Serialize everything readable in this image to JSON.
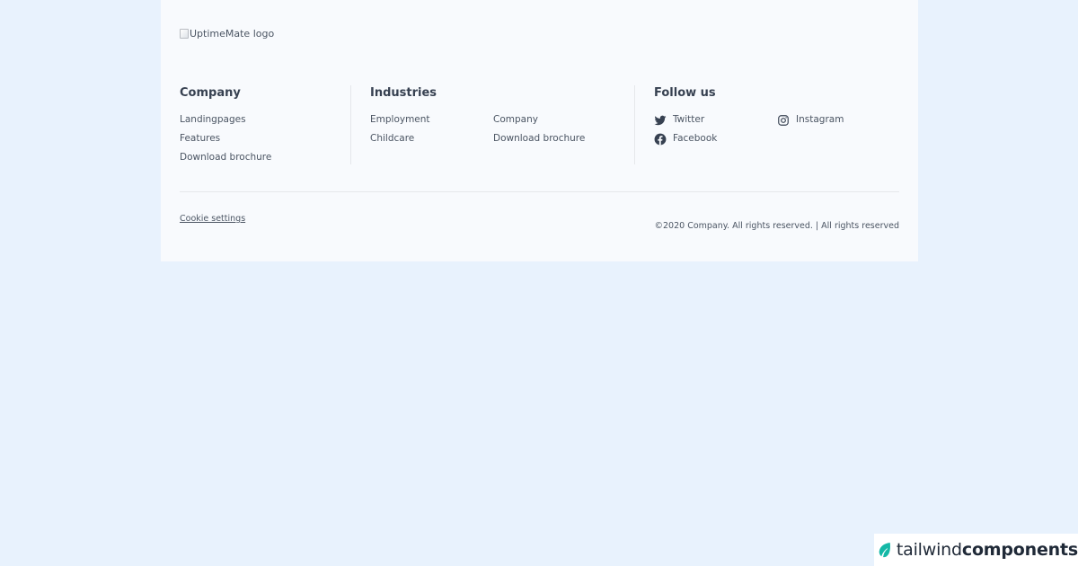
{
  "logo": {
    "alt_text": "UptimeMate logo"
  },
  "company": {
    "title": "Company",
    "links": [
      "Landingpages",
      "Features",
      "Download brochure"
    ]
  },
  "industries": {
    "title": "Industries",
    "links": [
      "Employment",
      "Company",
      "Childcare",
      "Download brochure"
    ]
  },
  "follow": {
    "title": "Follow us",
    "items": [
      {
        "label": "Twitter",
        "icon": "twitter-icon"
      },
      {
        "label": "Instagram",
        "icon": "instagram-icon"
      },
      {
        "label": "Facebook",
        "icon": "facebook-icon"
      }
    ]
  },
  "bottom": {
    "cookie_label": "Cookie settings",
    "copyright": "©2020 Company. All rights reserved. | All rights reserved"
  },
  "badge": {
    "brand_light": "tailwind",
    "brand_bold": "components",
    "accent": "#14b8a6"
  },
  "colors": {
    "page_bg": "#e8f2fd",
    "footer_bg": "#f8fafd",
    "text": "#4b5563",
    "heading": "#374151"
  }
}
